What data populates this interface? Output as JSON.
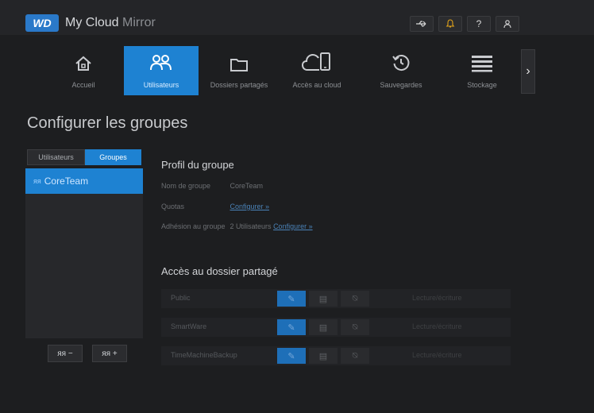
{
  "app": {
    "logo": "WD",
    "name_main": "My Cloud",
    "name_light": " Mirror"
  },
  "topbar": {
    "usb_icon": "usb-icon",
    "bell_icon": "bell-icon",
    "help_label": "?",
    "user_icon": "user-icon"
  },
  "nav": {
    "items": [
      {
        "label": "Accueil",
        "icon": "home-icon"
      },
      {
        "label": "Utilisateurs",
        "icon": "users-icon"
      },
      {
        "label": "Dossiers partagés",
        "icon": "folder-icon"
      },
      {
        "label": "Accès au cloud",
        "icon": "cloud-device-icon"
      },
      {
        "label": "Sauvegardes",
        "icon": "backup-icon"
      },
      {
        "label": "Stockage",
        "icon": "storage-icon"
      }
    ],
    "active_index": 1
  },
  "page": {
    "title": "Configurer les groupes"
  },
  "left": {
    "seg_users": "Utilisateurs",
    "seg_groups": "Groupes",
    "group_name": "CoreTeam",
    "remove_label": "ᴙᴙ −",
    "add_label": "ᴙᴙ +"
  },
  "profile": {
    "title": "Profil du groupe",
    "rows": [
      {
        "key": "Nom de groupe",
        "value": "CoreTeam",
        "link": ""
      },
      {
        "key": "Quotas",
        "value": "",
        "link": "Configurer »"
      },
      {
        "key": "Adhésion au groupe",
        "value": "2 Utilisateurs",
        "link": "Configurer »"
      }
    ]
  },
  "shares": {
    "title": "Accès au dossier partagé",
    "rows": [
      {
        "name": "Public",
        "status": "Lecture/écriture"
      },
      {
        "name": "SmartWare",
        "status": "Lecture/écriture"
      },
      {
        "name": "TimeMachineBackup",
        "status": "Lecture/écriture"
      }
    ]
  },
  "colors": {
    "accent": "#1e82d2",
    "background": "#1d1e20",
    "bell": "#e0a21a"
  }
}
